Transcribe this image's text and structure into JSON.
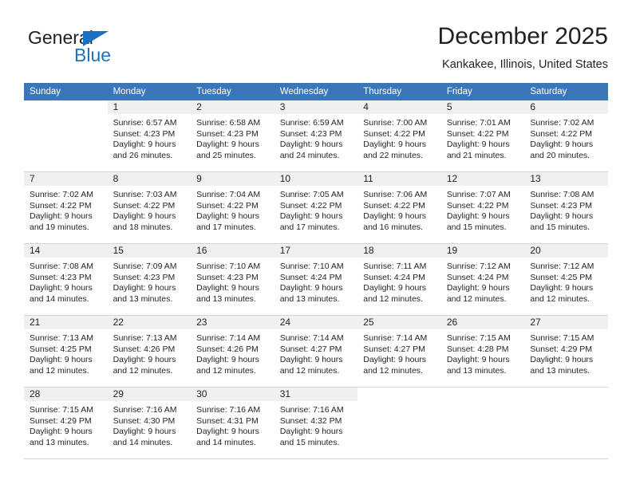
{
  "brand": {
    "line1": "General",
    "line2": "Blue",
    "triangle_color": "#1a71c4"
  },
  "header": {
    "title": "December 2025",
    "subtitle": "Kankakee, Illinois, United States",
    "header_bg": "#3b76b8",
    "daynum_bg": "#f0f0f0"
  },
  "weekdays": [
    "Sunday",
    "Monday",
    "Tuesday",
    "Wednesday",
    "Thursday",
    "Friday",
    "Saturday"
  ],
  "weeks": [
    [
      {
        "day": "",
        "sunrise": "",
        "sunset": "",
        "daylight_line1": "",
        "daylight_line2": ""
      },
      {
        "day": "1",
        "sunrise": "Sunrise: 6:57 AM",
        "sunset": "Sunset: 4:23 PM",
        "daylight_line1": "Daylight: 9 hours",
        "daylight_line2": "and 26 minutes."
      },
      {
        "day": "2",
        "sunrise": "Sunrise: 6:58 AM",
        "sunset": "Sunset: 4:23 PM",
        "daylight_line1": "Daylight: 9 hours",
        "daylight_line2": "and 25 minutes."
      },
      {
        "day": "3",
        "sunrise": "Sunrise: 6:59 AM",
        "sunset": "Sunset: 4:23 PM",
        "daylight_line1": "Daylight: 9 hours",
        "daylight_line2": "and 24 minutes."
      },
      {
        "day": "4",
        "sunrise": "Sunrise: 7:00 AM",
        "sunset": "Sunset: 4:22 PM",
        "daylight_line1": "Daylight: 9 hours",
        "daylight_line2": "and 22 minutes."
      },
      {
        "day": "5",
        "sunrise": "Sunrise: 7:01 AM",
        "sunset": "Sunset: 4:22 PM",
        "daylight_line1": "Daylight: 9 hours",
        "daylight_line2": "and 21 minutes."
      },
      {
        "day": "6",
        "sunrise": "Sunrise: 7:02 AM",
        "sunset": "Sunset: 4:22 PM",
        "daylight_line1": "Daylight: 9 hours",
        "daylight_line2": "and 20 minutes."
      }
    ],
    [
      {
        "day": "7",
        "sunrise": "Sunrise: 7:02 AM",
        "sunset": "Sunset: 4:22 PM",
        "daylight_line1": "Daylight: 9 hours",
        "daylight_line2": "and 19 minutes."
      },
      {
        "day": "8",
        "sunrise": "Sunrise: 7:03 AM",
        "sunset": "Sunset: 4:22 PM",
        "daylight_line1": "Daylight: 9 hours",
        "daylight_line2": "and 18 minutes."
      },
      {
        "day": "9",
        "sunrise": "Sunrise: 7:04 AM",
        "sunset": "Sunset: 4:22 PM",
        "daylight_line1": "Daylight: 9 hours",
        "daylight_line2": "and 17 minutes."
      },
      {
        "day": "10",
        "sunrise": "Sunrise: 7:05 AM",
        "sunset": "Sunset: 4:22 PM",
        "daylight_line1": "Daylight: 9 hours",
        "daylight_line2": "and 17 minutes."
      },
      {
        "day": "11",
        "sunrise": "Sunrise: 7:06 AM",
        "sunset": "Sunset: 4:22 PM",
        "daylight_line1": "Daylight: 9 hours",
        "daylight_line2": "and 16 minutes."
      },
      {
        "day": "12",
        "sunrise": "Sunrise: 7:07 AM",
        "sunset": "Sunset: 4:22 PM",
        "daylight_line1": "Daylight: 9 hours",
        "daylight_line2": "and 15 minutes."
      },
      {
        "day": "13",
        "sunrise": "Sunrise: 7:08 AM",
        "sunset": "Sunset: 4:23 PM",
        "daylight_line1": "Daylight: 9 hours",
        "daylight_line2": "and 15 minutes."
      }
    ],
    [
      {
        "day": "14",
        "sunrise": "Sunrise: 7:08 AM",
        "sunset": "Sunset: 4:23 PM",
        "daylight_line1": "Daylight: 9 hours",
        "daylight_line2": "and 14 minutes."
      },
      {
        "day": "15",
        "sunrise": "Sunrise: 7:09 AM",
        "sunset": "Sunset: 4:23 PM",
        "daylight_line1": "Daylight: 9 hours",
        "daylight_line2": "and 13 minutes."
      },
      {
        "day": "16",
        "sunrise": "Sunrise: 7:10 AM",
        "sunset": "Sunset: 4:23 PM",
        "daylight_line1": "Daylight: 9 hours",
        "daylight_line2": "and 13 minutes."
      },
      {
        "day": "17",
        "sunrise": "Sunrise: 7:10 AM",
        "sunset": "Sunset: 4:24 PM",
        "daylight_line1": "Daylight: 9 hours",
        "daylight_line2": "and 13 minutes."
      },
      {
        "day": "18",
        "sunrise": "Sunrise: 7:11 AM",
        "sunset": "Sunset: 4:24 PM",
        "daylight_line1": "Daylight: 9 hours",
        "daylight_line2": "and 12 minutes."
      },
      {
        "day": "19",
        "sunrise": "Sunrise: 7:12 AM",
        "sunset": "Sunset: 4:24 PM",
        "daylight_line1": "Daylight: 9 hours",
        "daylight_line2": "and 12 minutes."
      },
      {
        "day": "20",
        "sunrise": "Sunrise: 7:12 AM",
        "sunset": "Sunset: 4:25 PM",
        "daylight_line1": "Daylight: 9 hours",
        "daylight_line2": "and 12 minutes."
      }
    ],
    [
      {
        "day": "21",
        "sunrise": "Sunrise: 7:13 AM",
        "sunset": "Sunset: 4:25 PM",
        "daylight_line1": "Daylight: 9 hours",
        "daylight_line2": "and 12 minutes."
      },
      {
        "day": "22",
        "sunrise": "Sunrise: 7:13 AM",
        "sunset": "Sunset: 4:26 PM",
        "daylight_line1": "Daylight: 9 hours",
        "daylight_line2": "and 12 minutes."
      },
      {
        "day": "23",
        "sunrise": "Sunrise: 7:14 AM",
        "sunset": "Sunset: 4:26 PM",
        "daylight_line1": "Daylight: 9 hours",
        "daylight_line2": "and 12 minutes."
      },
      {
        "day": "24",
        "sunrise": "Sunrise: 7:14 AM",
        "sunset": "Sunset: 4:27 PM",
        "daylight_line1": "Daylight: 9 hours",
        "daylight_line2": "and 12 minutes."
      },
      {
        "day": "25",
        "sunrise": "Sunrise: 7:14 AM",
        "sunset": "Sunset: 4:27 PM",
        "daylight_line1": "Daylight: 9 hours",
        "daylight_line2": "and 12 minutes."
      },
      {
        "day": "26",
        "sunrise": "Sunrise: 7:15 AM",
        "sunset": "Sunset: 4:28 PM",
        "daylight_line1": "Daylight: 9 hours",
        "daylight_line2": "and 13 minutes."
      },
      {
        "day": "27",
        "sunrise": "Sunrise: 7:15 AM",
        "sunset": "Sunset: 4:29 PM",
        "daylight_line1": "Daylight: 9 hours",
        "daylight_line2": "and 13 minutes."
      }
    ],
    [
      {
        "day": "28",
        "sunrise": "Sunrise: 7:15 AM",
        "sunset": "Sunset: 4:29 PM",
        "daylight_line1": "Daylight: 9 hours",
        "daylight_line2": "and 13 minutes."
      },
      {
        "day": "29",
        "sunrise": "Sunrise: 7:16 AM",
        "sunset": "Sunset: 4:30 PM",
        "daylight_line1": "Daylight: 9 hours",
        "daylight_line2": "and 14 minutes."
      },
      {
        "day": "30",
        "sunrise": "Sunrise: 7:16 AM",
        "sunset": "Sunset: 4:31 PM",
        "daylight_line1": "Daylight: 9 hours",
        "daylight_line2": "and 14 minutes."
      },
      {
        "day": "31",
        "sunrise": "Sunrise: 7:16 AM",
        "sunset": "Sunset: 4:32 PM",
        "daylight_line1": "Daylight: 9 hours",
        "daylight_line2": "and 15 minutes."
      },
      {
        "day": "",
        "sunrise": "",
        "sunset": "",
        "daylight_line1": "",
        "daylight_line2": ""
      },
      {
        "day": "",
        "sunrise": "",
        "sunset": "",
        "daylight_line1": "",
        "daylight_line2": ""
      },
      {
        "day": "",
        "sunrise": "",
        "sunset": "",
        "daylight_line1": "",
        "daylight_line2": ""
      }
    ]
  ]
}
